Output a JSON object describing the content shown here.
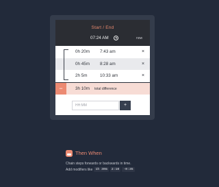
{
  "card": {
    "title": "Start / End",
    "start_time": "07:24 AM",
    "now_label": "now"
  },
  "entries": [
    {
      "duration": "0h 20m",
      "time": "7:43 am",
      "remove": "×"
    },
    {
      "duration": "0h 45m",
      "time": "8:28 am",
      "remove": "×"
    },
    {
      "duration": "2h 5m",
      "time": "10:33 am",
      "remove": "×"
    }
  ],
  "total": {
    "minus": "−",
    "duration": "3h 10m",
    "label": "total difference"
  },
  "input": {
    "placeholder": "HH:MM",
    "add": "+"
  },
  "brand": {
    "name": "Then When",
    "description": "Chain steps forwards or backwards in time.",
    "modifiers_prefix": "Add modifiers like",
    "modifiers": [
      "1h 30m",
      "2:10",
      "-0:35"
    ]
  },
  "colors": {
    "background": "#222a3a",
    "accent": "#ec8a72",
    "total_row": "#f7dcd5"
  }
}
